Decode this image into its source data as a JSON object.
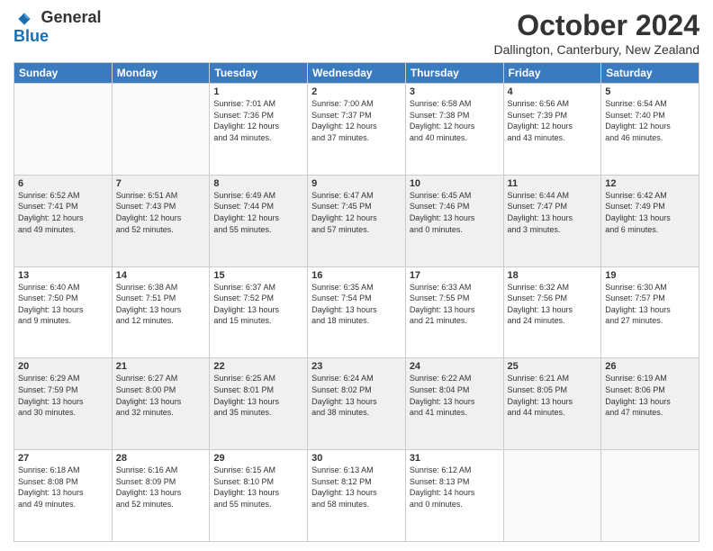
{
  "header": {
    "logo": {
      "line1": "General",
      "line2": "Blue"
    },
    "title": "October 2024",
    "subtitle": "Dallington, Canterbury, New Zealand"
  },
  "days_of_week": [
    "Sunday",
    "Monday",
    "Tuesday",
    "Wednesday",
    "Thursday",
    "Friday",
    "Saturday"
  ],
  "weeks": [
    [
      {
        "day": "",
        "info": ""
      },
      {
        "day": "",
        "info": ""
      },
      {
        "day": "1",
        "info": "Sunrise: 7:01 AM\nSunset: 7:36 PM\nDaylight: 12 hours\nand 34 minutes."
      },
      {
        "day": "2",
        "info": "Sunrise: 7:00 AM\nSunset: 7:37 PM\nDaylight: 12 hours\nand 37 minutes."
      },
      {
        "day": "3",
        "info": "Sunrise: 6:58 AM\nSunset: 7:38 PM\nDaylight: 12 hours\nand 40 minutes."
      },
      {
        "day": "4",
        "info": "Sunrise: 6:56 AM\nSunset: 7:39 PM\nDaylight: 12 hours\nand 43 minutes."
      },
      {
        "day": "5",
        "info": "Sunrise: 6:54 AM\nSunset: 7:40 PM\nDaylight: 12 hours\nand 46 minutes."
      }
    ],
    [
      {
        "day": "6",
        "info": "Sunrise: 6:52 AM\nSunset: 7:41 PM\nDaylight: 12 hours\nand 49 minutes."
      },
      {
        "day": "7",
        "info": "Sunrise: 6:51 AM\nSunset: 7:43 PM\nDaylight: 12 hours\nand 52 minutes."
      },
      {
        "day": "8",
        "info": "Sunrise: 6:49 AM\nSunset: 7:44 PM\nDaylight: 12 hours\nand 55 minutes."
      },
      {
        "day": "9",
        "info": "Sunrise: 6:47 AM\nSunset: 7:45 PM\nDaylight: 12 hours\nand 57 minutes."
      },
      {
        "day": "10",
        "info": "Sunrise: 6:45 AM\nSunset: 7:46 PM\nDaylight: 13 hours\nand 0 minutes."
      },
      {
        "day": "11",
        "info": "Sunrise: 6:44 AM\nSunset: 7:47 PM\nDaylight: 13 hours\nand 3 minutes."
      },
      {
        "day": "12",
        "info": "Sunrise: 6:42 AM\nSunset: 7:49 PM\nDaylight: 13 hours\nand 6 minutes."
      }
    ],
    [
      {
        "day": "13",
        "info": "Sunrise: 6:40 AM\nSunset: 7:50 PM\nDaylight: 13 hours\nand 9 minutes."
      },
      {
        "day": "14",
        "info": "Sunrise: 6:38 AM\nSunset: 7:51 PM\nDaylight: 13 hours\nand 12 minutes."
      },
      {
        "day": "15",
        "info": "Sunrise: 6:37 AM\nSunset: 7:52 PM\nDaylight: 13 hours\nand 15 minutes."
      },
      {
        "day": "16",
        "info": "Sunrise: 6:35 AM\nSunset: 7:54 PM\nDaylight: 13 hours\nand 18 minutes."
      },
      {
        "day": "17",
        "info": "Sunrise: 6:33 AM\nSunset: 7:55 PM\nDaylight: 13 hours\nand 21 minutes."
      },
      {
        "day": "18",
        "info": "Sunrise: 6:32 AM\nSunset: 7:56 PM\nDaylight: 13 hours\nand 24 minutes."
      },
      {
        "day": "19",
        "info": "Sunrise: 6:30 AM\nSunset: 7:57 PM\nDaylight: 13 hours\nand 27 minutes."
      }
    ],
    [
      {
        "day": "20",
        "info": "Sunrise: 6:29 AM\nSunset: 7:59 PM\nDaylight: 13 hours\nand 30 minutes."
      },
      {
        "day": "21",
        "info": "Sunrise: 6:27 AM\nSunset: 8:00 PM\nDaylight: 13 hours\nand 32 minutes."
      },
      {
        "day": "22",
        "info": "Sunrise: 6:25 AM\nSunset: 8:01 PM\nDaylight: 13 hours\nand 35 minutes."
      },
      {
        "day": "23",
        "info": "Sunrise: 6:24 AM\nSunset: 8:02 PM\nDaylight: 13 hours\nand 38 minutes."
      },
      {
        "day": "24",
        "info": "Sunrise: 6:22 AM\nSunset: 8:04 PM\nDaylight: 13 hours\nand 41 minutes."
      },
      {
        "day": "25",
        "info": "Sunrise: 6:21 AM\nSunset: 8:05 PM\nDaylight: 13 hours\nand 44 minutes."
      },
      {
        "day": "26",
        "info": "Sunrise: 6:19 AM\nSunset: 8:06 PM\nDaylight: 13 hours\nand 47 minutes."
      }
    ],
    [
      {
        "day": "27",
        "info": "Sunrise: 6:18 AM\nSunset: 8:08 PM\nDaylight: 13 hours\nand 49 minutes."
      },
      {
        "day": "28",
        "info": "Sunrise: 6:16 AM\nSunset: 8:09 PM\nDaylight: 13 hours\nand 52 minutes."
      },
      {
        "day": "29",
        "info": "Sunrise: 6:15 AM\nSunset: 8:10 PM\nDaylight: 13 hours\nand 55 minutes."
      },
      {
        "day": "30",
        "info": "Sunrise: 6:13 AM\nSunset: 8:12 PM\nDaylight: 13 hours\nand 58 minutes."
      },
      {
        "day": "31",
        "info": "Sunrise: 6:12 AM\nSunset: 8:13 PM\nDaylight: 14 hours\nand 0 minutes."
      },
      {
        "day": "",
        "info": ""
      },
      {
        "day": "",
        "info": ""
      }
    ]
  ]
}
